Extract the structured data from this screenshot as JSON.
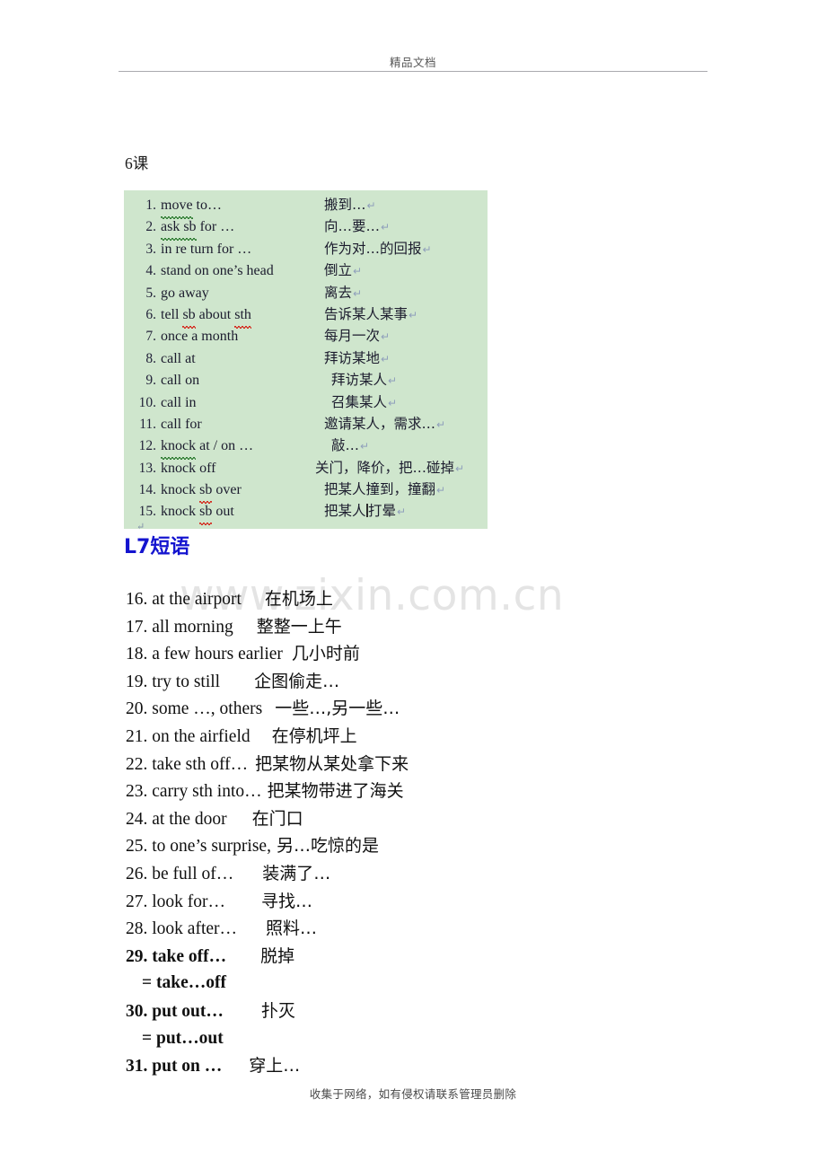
{
  "header": {
    "title": "精品文档"
  },
  "lesson_label": "6课",
  "green_table": {
    "rows": [
      {
        "num": "1.",
        "en_pre": "",
        "en_sq_grn": "move",
        "en_post": " to…",
        "cn": "搬到…",
        "pilcrow": "↵",
        "cn_indent": "ind1"
      },
      {
        "num": "2.",
        "en_pre": "",
        "en_sq_grn": "ask sb",
        "en_post": " for …",
        "cn": "向…要…",
        "pilcrow": "↵",
        "cn_indent": "ind1"
      },
      {
        "num": "3.",
        "en_pre": "in re turn for …",
        "en_sq_grn": "",
        "en_post": "",
        "cn": "作为对…的回报",
        "pilcrow": "↵",
        "cn_indent": "ind1"
      },
      {
        "num": "4.",
        "en_pre": "stand on one’s head",
        "en_sq_grn": "",
        "en_post": "",
        "cn": "倒立",
        "pilcrow": "↵",
        "cn_indent": "ind1"
      },
      {
        "num": "5.",
        "en_pre": "go away",
        "en_sq_grn": "",
        "en_post": "",
        "cn": "离去",
        "pilcrow": "↵",
        "cn_indent": "ind1"
      },
      {
        "num": "6.",
        "en_pre": "tell ",
        "en_sq_red": "sb",
        "en_mid": " about ",
        "en_sq_red2": "sth",
        "en_post": "",
        "cn": "告诉某人某事",
        "pilcrow": "↵",
        "cn_indent": "ind1"
      },
      {
        "num": "7.",
        "en_pre": "once a month",
        "en_sq_grn": "",
        "en_post": "",
        "cn": "每月一次",
        "pilcrow": "↵",
        "cn_indent": "ind1"
      },
      {
        "num": "8.",
        "en_pre": "call at",
        "en_sq_grn": "",
        "en_post": "",
        "cn": "拜访某地",
        "pilcrow": "↵",
        "cn_indent": "ind1"
      },
      {
        "num": "9.",
        "en_pre": "call on",
        "en_sq_grn": "",
        "en_post": "",
        "cn": "拜访某人",
        "pilcrow": "↵",
        "cn_indent": "ind2"
      },
      {
        "num": "10.",
        "en_pre": "call in",
        "en_sq_grn": "",
        "en_post": "",
        "cn": "召集某人",
        "pilcrow": "↵",
        "cn_indent": "ind2"
      },
      {
        "num": "11.",
        "en_pre": "call for",
        "en_sq_grn": "",
        "en_post": "",
        "cn": "邀请某人，需求…",
        "pilcrow": "↵",
        "cn_indent": "ind1"
      },
      {
        "num": "12.",
        "en_pre": "",
        "en_sq_grn": "knock",
        "en_post": " at / on …",
        "cn": "敲…",
        "pilcrow": "↵",
        "cn_indent": "ind2"
      },
      {
        "num": "13.",
        "en_pre": "knock off",
        "en_sq_grn": "",
        "en_post": "",
        "cn": "关门，降价，把…碰掉",
        "pilcrow": "↵",
        "cn_indent": "ind-neg"
      },
      {
        "num": "14.",
        "en_pre": "knock ",
        "en_sq_red": "sb",
        "en_mid": " over",
        "en_sq_red2": "",
        "en_post": "",
        "cn": "把某人撞到，撞翻",
        "pilcrow": "↵",
        "cn_indent": "ind1"
      },
      {
        "num": "15.",
        "en_pre": "knock ",
        "en_sq_red": "sb",
        "en_mid": " out",
        "en_sq_red2": "",
        "en_post": "",
        "cn_before": "把某人",
        "cn_after": "打晕",
        "has_caret": true,
        "pilcrow": "↵",
        "cn_indent": "ind1"
      }
    ],
    "end_mark": "↵",
    "bg_color": "#cfe6cd"
  },
  "l7_heading": {
    "text": "L7短语",
    "color": "#1414cf"
  },
  "watermark": "www.zixin.com.cn",
  "plain_list": {
    "rows": [
      {
        "en": "16. at the airport",
        "gap": 26,
        "cn": "在机场上",
        "bold": false
      },
      {
        "en": "17. all morning",
        "gap": 26,
        "cn": "整整一上午",
        "bold": false
      },
      {
        "en": "18. a few hours earlier",
        "gap": 10,
        "cn": "几小时前",
        "bold": false
      },
      {
        "en": "19. try to still",
        "gap": 38,
        "cn": "企图偷走…",
        "bold": false
      },
      {
        "en": "20. some …, others",
        "gap": 14,
        "cn": "一些…,另一些…",
        "bold": false
      },
      {
        "en": "21. on the airfield",
        "gap": 24,
        "cn": "在停机坪上",
        "bold": false
      },
      {
        "en": "22. take sth off…",
        "gap": 8,
        "cn": "把某物从某处拿下来",
        "bold": false
      },
      {
        "en": "23. carry sth into…",
        "gap": 6,
        "cn": "把某物带进了海关",
        "bold": false
      },
      {
        "en": "24. at the door",
        "gap": 28,
        "cn": "在门口",
        "bold": false
      },
      {
        "en": "25. to one’s surprise,",
        "gap": 6,
        "cn": "另…吃惊的是",
        "bold": false
      },
      {
        "en": "26. be full of…",
        "gap": 32,
        "cn": "装满了…",
        "bold": false
      },
      {
        "en": "27. look for…",
        "gap": 40,
        "cn": "寻找…",
        "bold": false
      },
      {
        "en": "28. look after…",
        "gap": 32,
        "cn": "照料…",
        "bold": false
      },
      {
        "en": "29. take off…",
        "gap": 38,
        "cn": "脱掉",
        "bold": true
      },
      {
        "en": "= take…off",
        "gap": 0,
        "cn": "",
        "bold": true,
        "continuation": true
      },
      {
        "en": "30. put out…",
        "gap": 42,
        "cn": "扑灭",
        "bold": true
      },
      {
        "en": "= put…out",
        "gap": 0,
        "cn": "",
        "bold": true,
        "continuation": true
      },
      {
        "en": "31. put on …",
        "gap": 30,
        "cn": "穿上…",
        "bold": true
      }
    ]
  },
  "footer": "收集于网络，如有侵权请联系管理员删除"
}
